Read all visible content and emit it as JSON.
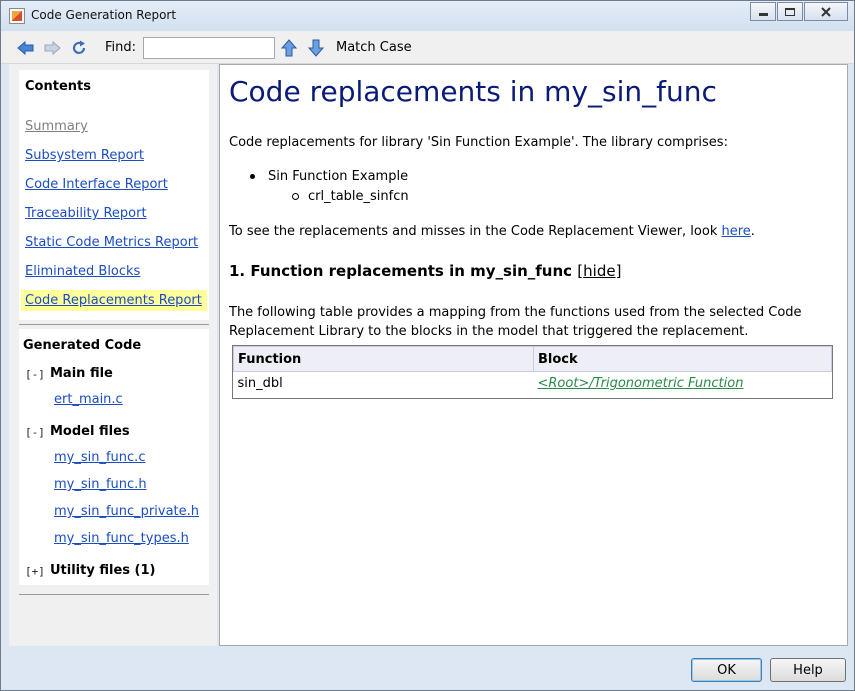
{
  "window": {
    "title": "Code Generation Report"
  },
  "toolbar": {
    "find_label": "Find:",
    "find_value": "",
    "find_placeholder": "",
    "match_case_label": "Match Case",
    "icons": [
      "back-icon",
      "forward-icon",
      "refresh-icon",
      "find-previous-icon",
      "find-next-icon"
    ]
  },
  "sidebar": {
    "contents_title": "Contents",
    "contents_items": [
      {
        "label": "Summary",
        "state": "disabled"
      },
      {
        "label": "Subsystem Report",
        "state": "link"
      },
      {
        "label": "Code Interface Report",
        "state": "link"
      },
      {
        "label": "Traceability Report",
        "state": "link"
      },
      {
        "label": "Static Code Metrics Report",
        "state": "link"
      },
      {
        "label": "Eliminated Blocks",
        "state": "link"
      },
      {
        "label": "Code Replacements Report",
        "state": "active"
      }
    ],
    "generated_code_title": "Generated Code",
    "groups": {
      "main": {
        "toggle": "[-]",
        "label": "Main file",
        "files": [
          "ert_main.c"
        ]
      },
      "model": {
        "toggle": "[-]",
        "label": "Model files",
        "files": [
          "my_sin_func.c",
          "my_sin_func.h",
          "my_sin_func_private.h",
          "my_sin_func_types.h"
        ]
      },
      "utility": {
        "toggle": "[+]",
        "label": "Utility files (1)"
      }
    }
  },
  "main": {
    "title": "Code replacements in my_sin_func",
    "intro": "Code replacements for library 'Sin Function Example'. The library comprises:",
    "library": "Sin Function Example",
    "table_name": "crl_table_sinfcn",
    "see_text": "To see the replacements and misses in the Code Replacement Viewer, look",
    "see_link": "here",
    "see_end": ".",
    "section_title": "1. Function replacements in my_sin_func",
    "hide_open": "[",
    "hide_label": "hide",
    "hide_close": "]",
    "table_desc_1": "The following table provides a mapping from the functions used from the selected Code",
    "table_desc_2": "Replacement Library to the blocks in the model that triggered the replacement.",
    "table": {
      "headers": [
        "Function",
        "Block"
      ],
      "rows": [
        {
          "function": "sin_dbl",
          "block": "<Root>/Trigonometric Function"
        }
      ]
    }
  },
  "buttons": {
    "ok": "OK",
    "help": "Help"
  },
  "colors": {
    "title_text": "#0a1a78",
    "link": "#1a4cc4",
    "active_highlight": "#ffff99",
    "block_link": "#2a8a4a"
  }
}
